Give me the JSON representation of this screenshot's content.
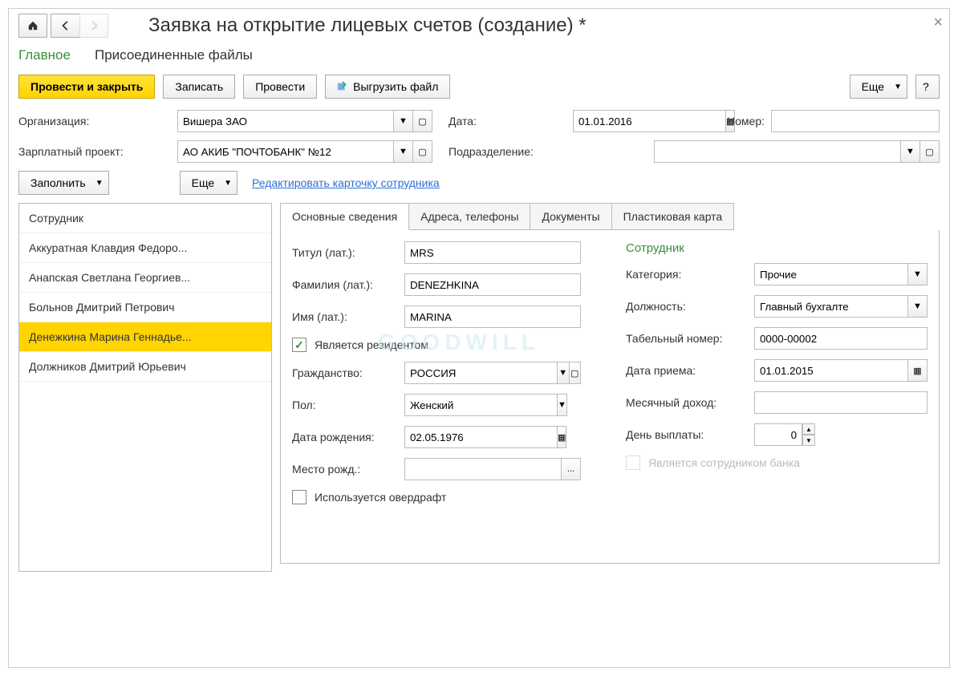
{
  "header": {
    "title": "Заявка на открытие лицевых счетов (создание) *"
  },
  "section_tabs": {
    "main": "Главное",
    "files": "Присоединенные файлы"
  },
  "toolbar": {
    "post_close": "Провести и закрыть",
    "save": "Записать",
    "post": "Провести",
    "export": "Выгрузить файл",
    "more": "Еще"
  },
  "top_form": {
    "org_label": "Организация:",
    "org_value": "Вишера ЗАО",
    "date_label": "Дата:",
    "date_value": "01.01.2016",
    "number_label": "Номер:",
    "number_value": "",
    "payroll_label": "Зарплатный проект:",
    "payroll_value": "АО АКИБ \"ПОЧТОБАНК\" №12",
    "dept_label": "Подразделение:",
    "dept_value": ""
  },
  "actions": {
    "fill": "Заполнить",
    "more2": "Еще",
    "edit_card": "Редактировать карточку сотрудника"
  },
  "emp_list": {
    "header": "Сотрудник",
    "items": [
      "Аккуратная Клавдия Федоро...",
      "Анапская Светлана Георгиев...",
      "Больнов Дмитрий Петрович",
      "Денежкина Марина Геннадье...",
      "Должников Дмитрий Юрьевич"
    ],
    "active_index": 3
  },
  "detail_tabs": {
    "main": "Основные сведения",
    "addr": "Адреса, телефоны",
    "docs": "Документы",
    "card": "Пластиковая карта"
  },
  "details": {
    "title_label": "Титул (лат.):",
    "title_value": "MRS",
    "lastname_label": "Фамилия (лат.):",
    "lastname_value": "DENEZHKINA",
    "firstname_label": "Имя (лат.):",
    "firstname_value": "MARINA",
    "resident_label": "Является резидентом",
    "resident_checked": true,
    "citizen_label": "Гражданство:",
    "citizen_value": "РОССИЯ",
    "sex_label": "Пол:",
    "sex_value": "Женский",
    "dob_label": "Дата рождения:",
    "dob_value": "02.05.1976",
    "birthplace_label": "Место рожд.:",
    "birthplace_value": "",
    "overdraft_label": "Используется овердрафт",
    "overdraft_checked": false,
    "emp_heading": "Сотрудник",
    "category_label": "Категория:",
    "category_value": "Прочие",
    "position_label": "Должность:",
    "position_value": "Главный бухгалте",
    "tabnum_label": "Табельный номер:",
    "tabnum_value": "0000-00002",
    "hiredate_label": "Дата приема:",
    "hiredate_value": "01.01.2015",
    "income_label": "Месячный доход:",
    "income_value": "",
    "payday_label": "День выплаты:",
    "payday_value": "0",
    "bank_emp_label": "Является сотрудником банка",
    "bank_emp_checked": false
  },
  "watermark": "GOODWILL"
}
